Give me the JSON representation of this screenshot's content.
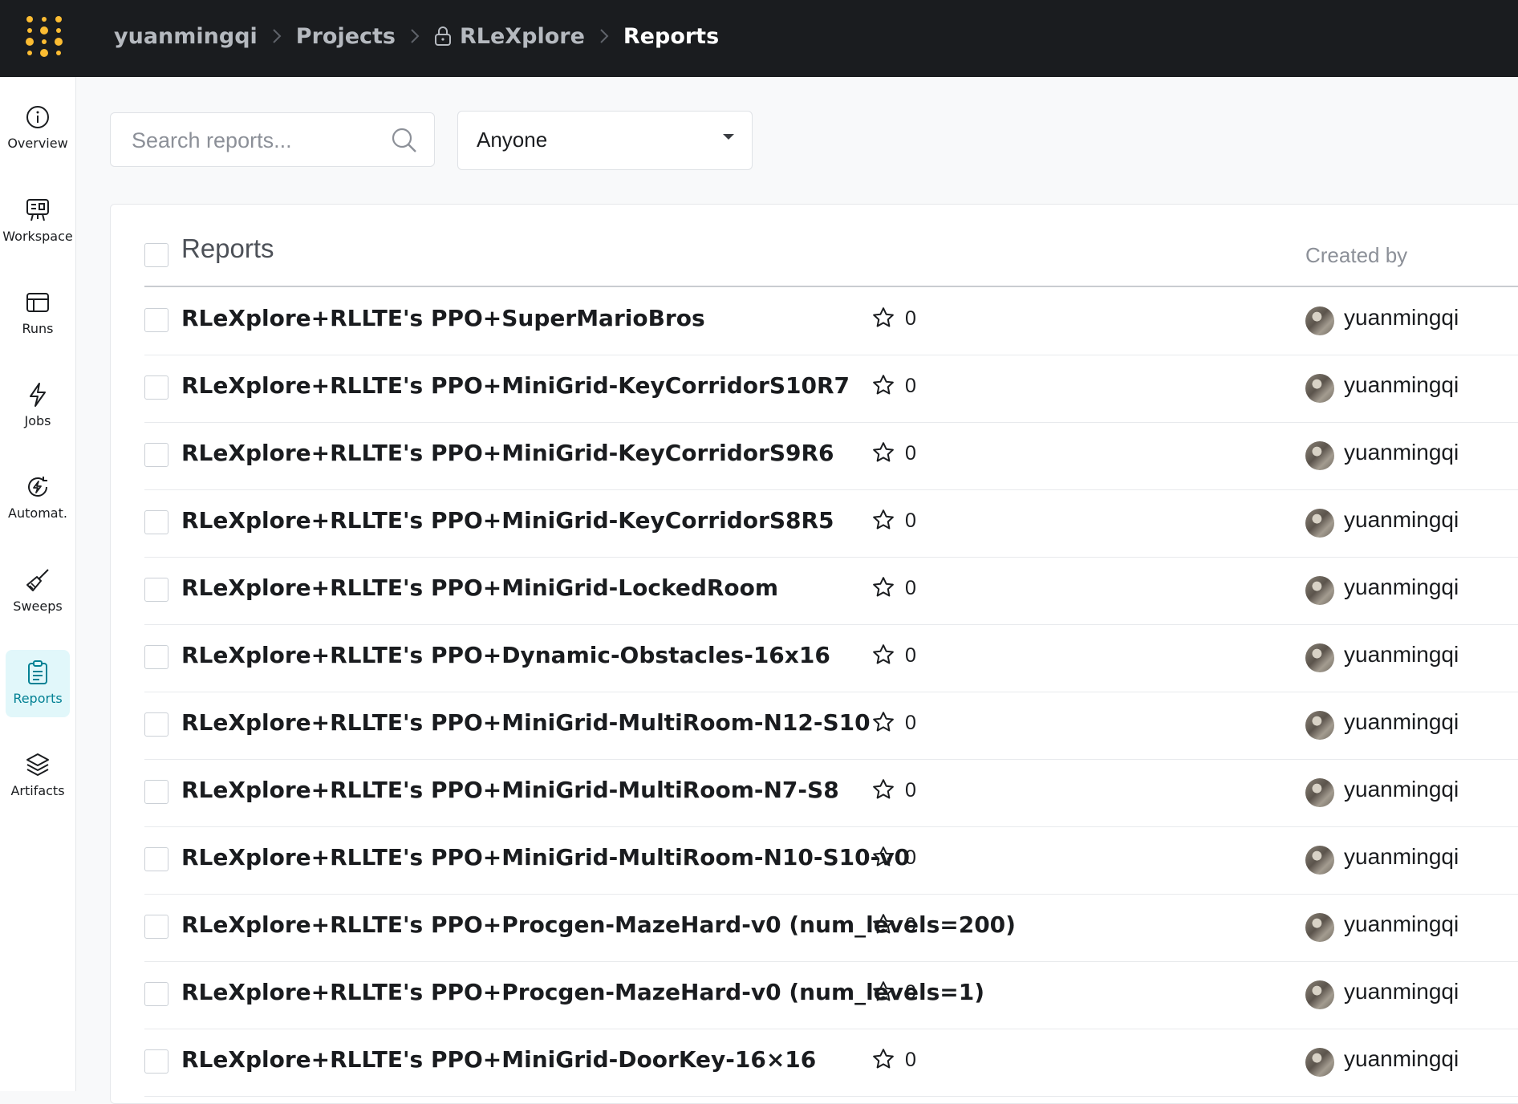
{
  "breadcrumb": {
    "user": "yuanmingqi",
    "projects": "Projects",
    "project": "RLeXplore",
    "current": "Reports"
  },
  "sidebar": {
    "items": [
      {
        "label": "Overview",
        "icon": "info-icon"
      },
      {
        "label": "Workspace",
        "icon": "workspace-icon"
      },
      {
        "label": "Runs",
        "icon": "table-icon"
      },
      {
        "label": "Jobs",
        "icon": "lightning-icon"
      },
      {
        "label": "Automat.",
        "icon": "automation-icon"
      },
      {
        "label": "Sweeps",
        "icon": "broom-icon"
      },
      {
        "label": "Reports",
        "icon": "clipboard-icon",
        "active": true
      },
      {
        "label": "Artifacts",
        "icon": "layers-icon"
      }
    ]
  },
  "search": {
    "placeholder": "Search reports..."
  },
  "filter": {
    "value": "Anyone"
  },
  "table": {
    "header_title": "Reports",
    "header_created_by": "Created by",
    "rows": [
      {
        "title": "RLeXplore+RLLTE's PPO+SuperMarioBros",
        "stars": "0",
        "creator": "yuanmingqi"
      },
      {
        "title": "RLeXplore+RLLTE's PPO+MiniGrid-KeyCorridorS10R7",
        "stars": "0",
        "creator": "yuanmingqi"
      },
      {
        "title": "RLeXplore+RLLTE's PPO+MiniGrid-KeyCorridorS9R6",
        "stars": "0",
        "creator": "yuanmingqi"
      },
      {
        "title": "RLeXplore+RLLTE's PPO+MiniGrid-KeyCorridorS8R5",
        "stars": "0",
        "creator": "yuanmingqi"
      },
      {
        "title": "RLeXplore+RLLTE's PPO+MiniGrid-LockedRoom",
        "stars": "0",
        "creator": "yuanmingqi"
      },
      {
        "title": "RLeXplore+RLLTE's PPO+Dynamic-Obstacles-16x16",
        "stars": "0",
        "creator": "yuanmingqi"
      },
      {
        "title": "RLeXplore+RLLTE's PPO+MiniGrid-MultiRoom-N12-S10",
        "stars": "0",
        "creator": "yuanmingqi"
      },
      {
        "title": "RLeXplore+RLLTE's PPO+MiniGrid-MultiRoom-N7-S8",
        "stars": "0",
        "creator": "yuanmingqi"
      },
      {
        "title": "RLeXplore+RLLTE's PPO+MiniGrid-MultiRoom-N10-S10-v0",
        "stars": "0",
        "creator": "yuanmingqi"
      },
      {
        "title": "RLeXplore+RLLTE's PPO+Procgen-MazeHard-v0 (num_levels=200)",
        "stars": "0",
        "creator": "yuanmingqi"
      },
      {
        "title": "RLeXplore+RLLTE's PPO+Procgen-MazeHard-v0 (num_levels=1)",
        "stars": "0",
        "creator": "yuanmingqi"
      },
      {
        "title": "RLeXplore+RLLTE's PPO+MiniGrid-DoorKey-16×16",
        "stars": "0",
        "creator": "yuanmingqi"
      }
    ]
  },
  "colors": {
    "topbar": "#1a1c1f",
    "accent": "#038194",
    "active_bg": "#e1f7fa",
    "logo": "#fcbc32"
  }
}
